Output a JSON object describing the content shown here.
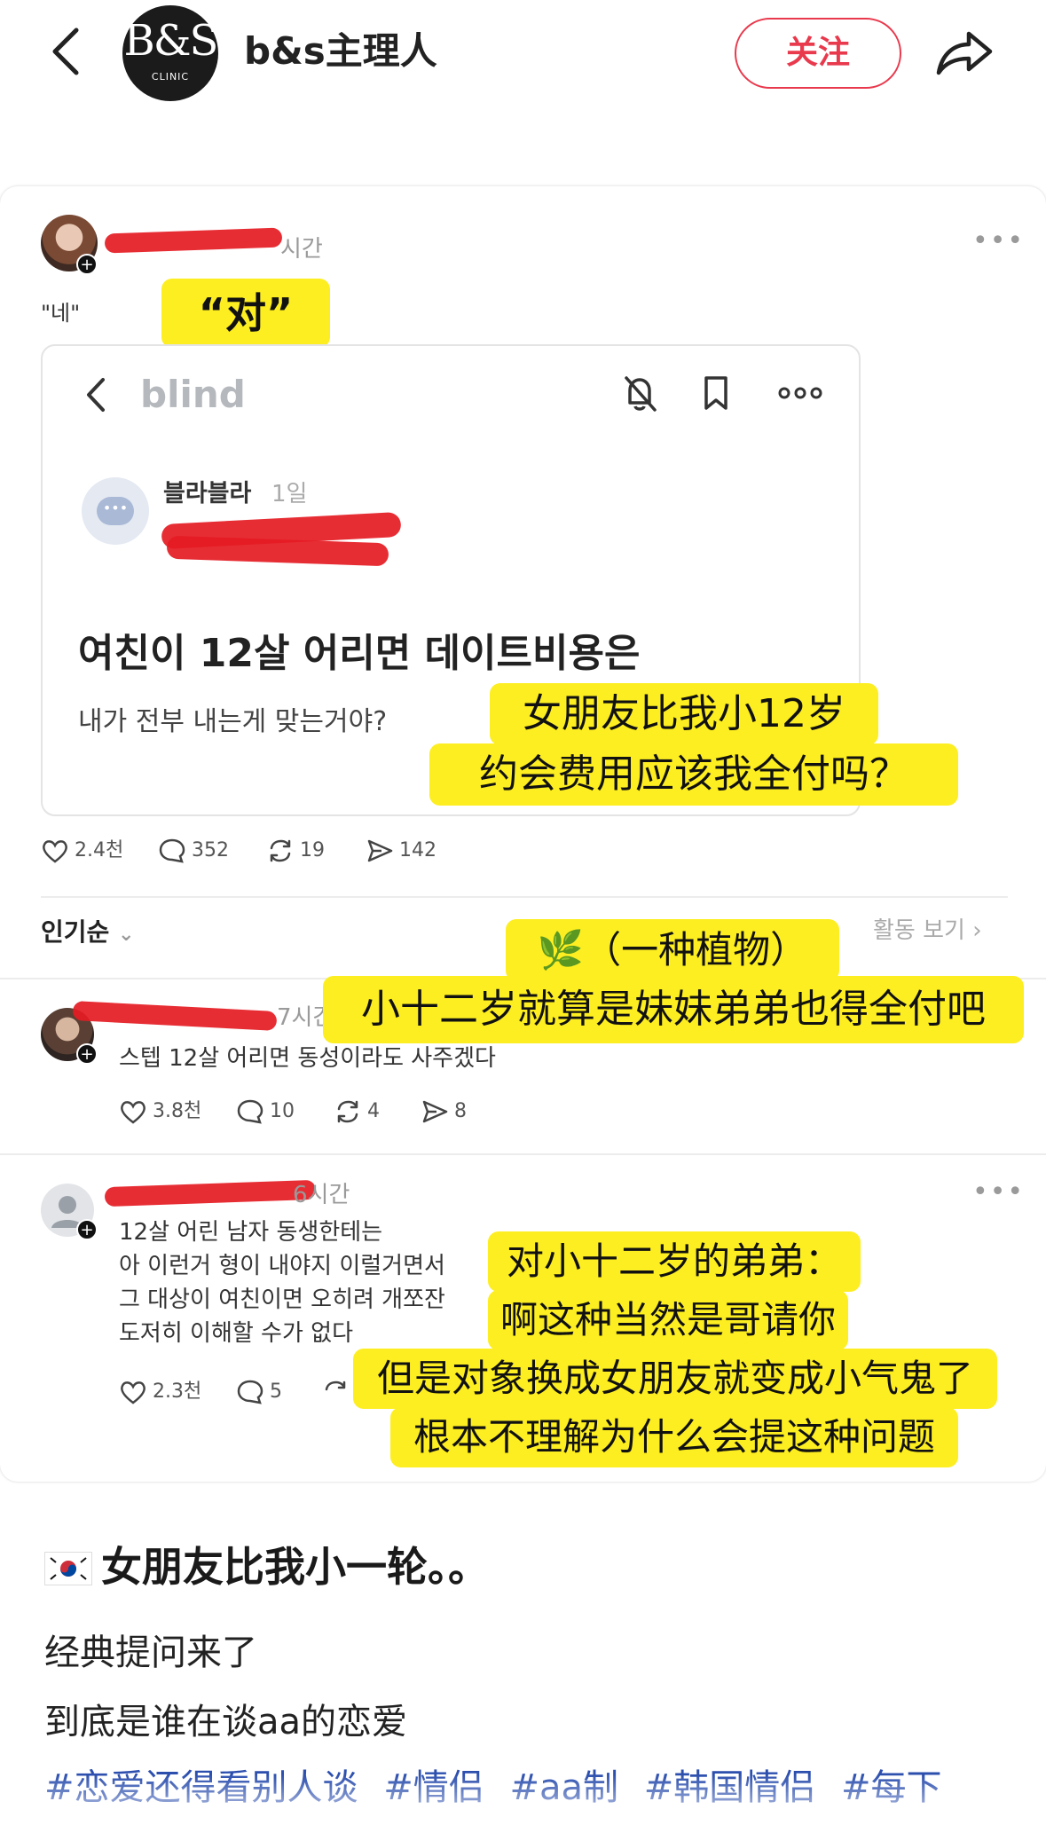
{
  "header": {
    "account_name": "b&s主理人",
    "logo_main": "B&S",
    "logo_sub": "CLINIC",
    "follow_label": "关注",
    "accent_color": "#e8394d"
  },
  "post": {
    "time": "시간",
    "quote_text": "\"네\"",
    "translation_yes": "“对”",
    "blind": {
      "logo": "blind",
      "author": "블라블라",
      "time": "1일",
      "title": "여친이 12살 어리면 데이트비용은",
      "subtitle": "내가 전부 내는게 맞는거야?",
      "translation_line1": "女朋友比我小12岁",
      "translation_line2": "约会费用应该我全付吗？"
    },
    "stats": {
      "likes": "2.4천",
      "comments": "352",
      "reposts": "19",
      "shares": "142"
    }
  },
  "sort": {
    "label": "인기순",
    "activity_label": "활동 보기"
  },
  "reply1": {
    "time": "7시간",
    "text": "스텝 12살 어리면 동성이라도 사주겠다",
    "tag_line1": "🌿（一种植物）",
    "tag_line2": "小十二岁就算是妹妹弟弟也得全付吧",
    "stats": {
      "likes": "3.8천",
      "comments": "10",
      "reposts": "4",
      "shares": "8"
    }
  },
  "reply2": {
    "time": "6시간",
    "lines": [
      "12살 어린 남자 동생한테는",
      "아 이런거 형이 내야지 이럴거면서",
      "그 대상이 여친이면 오히려 개쪼잔",
      "도저히 이해할 수가 없다"
    ],
    "tag_lines": [
      "对小十二岁的弟弟：",
      "啊这种当然是哥请你",
      "但是对象换成女朋友就变成小气鬼了",
      "根本不理解为什么会提这种问题"
    ],
    "stats": {
      "likes": "2.3천",
      "comments": "5"
    }
  },
  "caption": {
    "title": "女朋友比我小一轮。。",
    "line1": "经典提问来了",
    "line2": "到底是谁在谈aa的恋爱",
    "hashtags": [
      "#恋爱还得看别人谈",
      "#情侣",
      "#aa制",
      "#韩国情侣",
      "#每下"
    ]
  },
  "colors": {
    "highlight": "#fdee21",
    "redaction": "#e51b23",
    "hashtag": "#2c4fae"
  },
  "icons": [
    "back-icon",
    "share-icon",
    "more-icon",
    "bell-off-icon",
    "bookmark-icon",
    "heart-icon",
    "comment-icon",
    "repost-icon",
    "send-icon",
    "korea-flag-icon"
  ]
}
